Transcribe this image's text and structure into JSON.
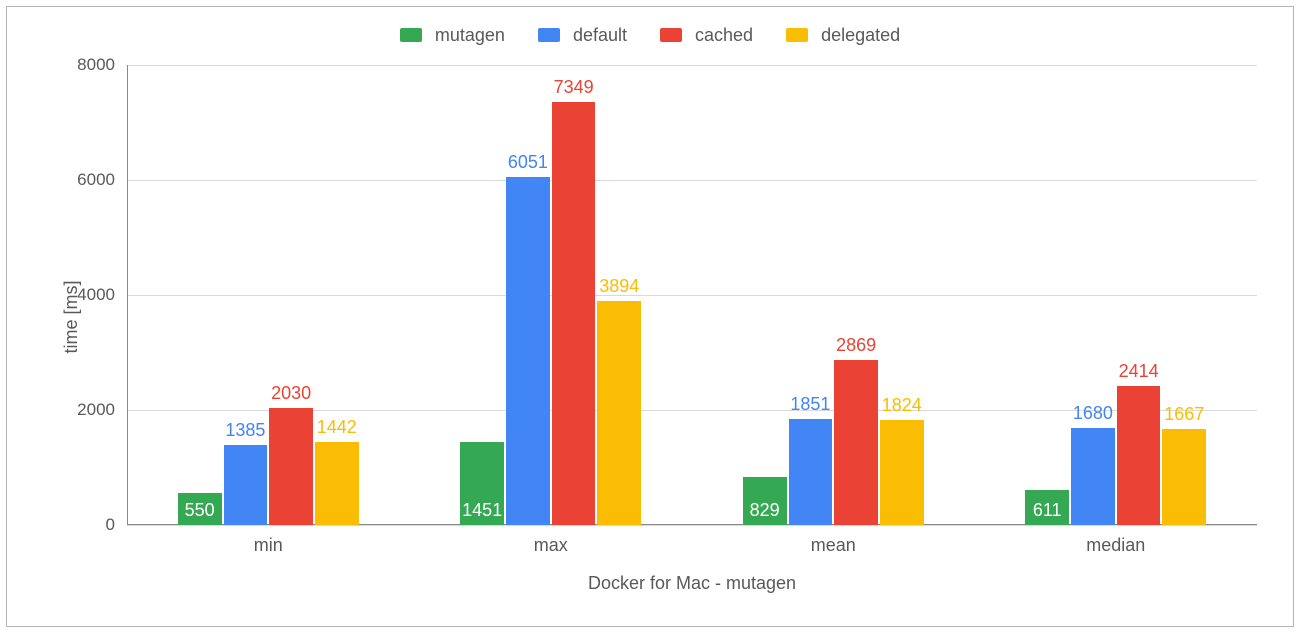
{
  "chart_data": {
    "type": "bar",
    "title": "",
    "xlabel": "Docker for Mac - mutagen",
    "ylabel": "time [ms]",
    "ylim": [
      0,
      8000
    ],
    "y_ticks": [
      0,
      2000,
      4000,
      6000,
      8000
    ],
    "categories": [
      "min",
      "max",
      "mean",
      "median"
    ],
    "series": [
      {
        "name": "mutagen",
        "color": "#34A853",
        "values": [
          550,
          1451,
          829,
          611
        ]
      },
      {
        "name": "default",
        "color": "#4285F4",
        "values": [
          1385,
          6051,
          1851,
          1680
        ]
      },
      {
        "name": "cached",
        "color": "#EA4335",
        "values": [
          2030,
          7349,
          2869,
          2414
        ]
      },
      {
        "name": "delegated",
        "color": "#FBBC04",
        "values": [
          1442,
          3894,
          1824,
          1667
        ]
      }
    ],
    "legend_position": "top",
    "grid": true
  }
}
